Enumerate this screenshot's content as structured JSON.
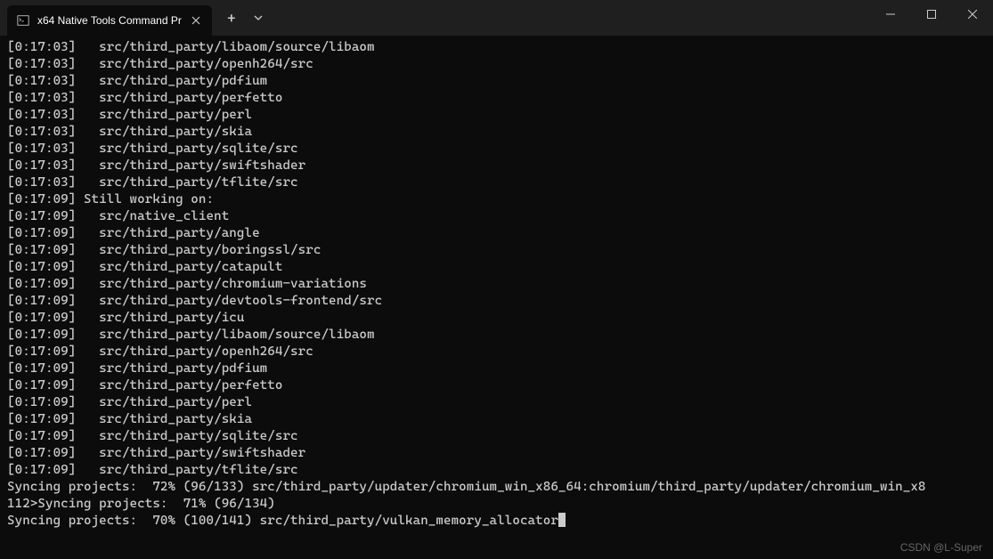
{
  "titlebar": {
    "tab_title": "x64 Native Tools Command Pr",
    "new_tab_glyph": "+",
    "dropdown_glyph": "⌄",
    "close_glyph": "✕"
  },
  "terminal": {
    "block1_timestamp": "[0:17:03]",
    "block1_items": [
      "src/third_party/libaom/source/libaom",
      "src/third_party/openh264/src",
      "src/third_party/pdfium",
      "src/third_party/perfetto",
      "src/third_party/perl",
      "src/third_party/skia",
      "src/third_party/sqlite/src",
      "src/third_party/swiftshader",
      "src/third_party/tflite/src"
    ],
    "block2_timestamp": "[0:17:09]",
    "block2_header": "Still working on:",
    "block2_items": [
      "src/native_client",
      "src/third_party/angle",
      "src/third_party/boringssl/src",
      "src/third_party/catapult",
      "src/third_party/chromium-variations",
      "src/third_party/devtools-frontend/src",
      "src/third_party/icu",
      "src/third_party/libaom/source/libaom",
      "src/third_party/openh264/src",
      "src/third_party/pdfium",
      "src/third_party/perfetto",
      "src/third_party/perl",
      "src/third_party/skia",
      "src/third_party/sqlite/src",
      "src/third_party/swiftshader",
      "src/third_party/tflite/src"
    ],
    "sync_line1": "Syncing projects:  72% (96/133) src/third_party/updater/chromium_win_x86_64:chromium/third_party/updater/chromium_win_x8",
    "sync_line2": "112>Syncing projects:  71% (96/134)",
    "sync_line3": "Syncing projects:  70% (100/141) src/third_party/vulkan_memory_allocator"
  },
  "watermark": "CSDN @L-Super"
}
